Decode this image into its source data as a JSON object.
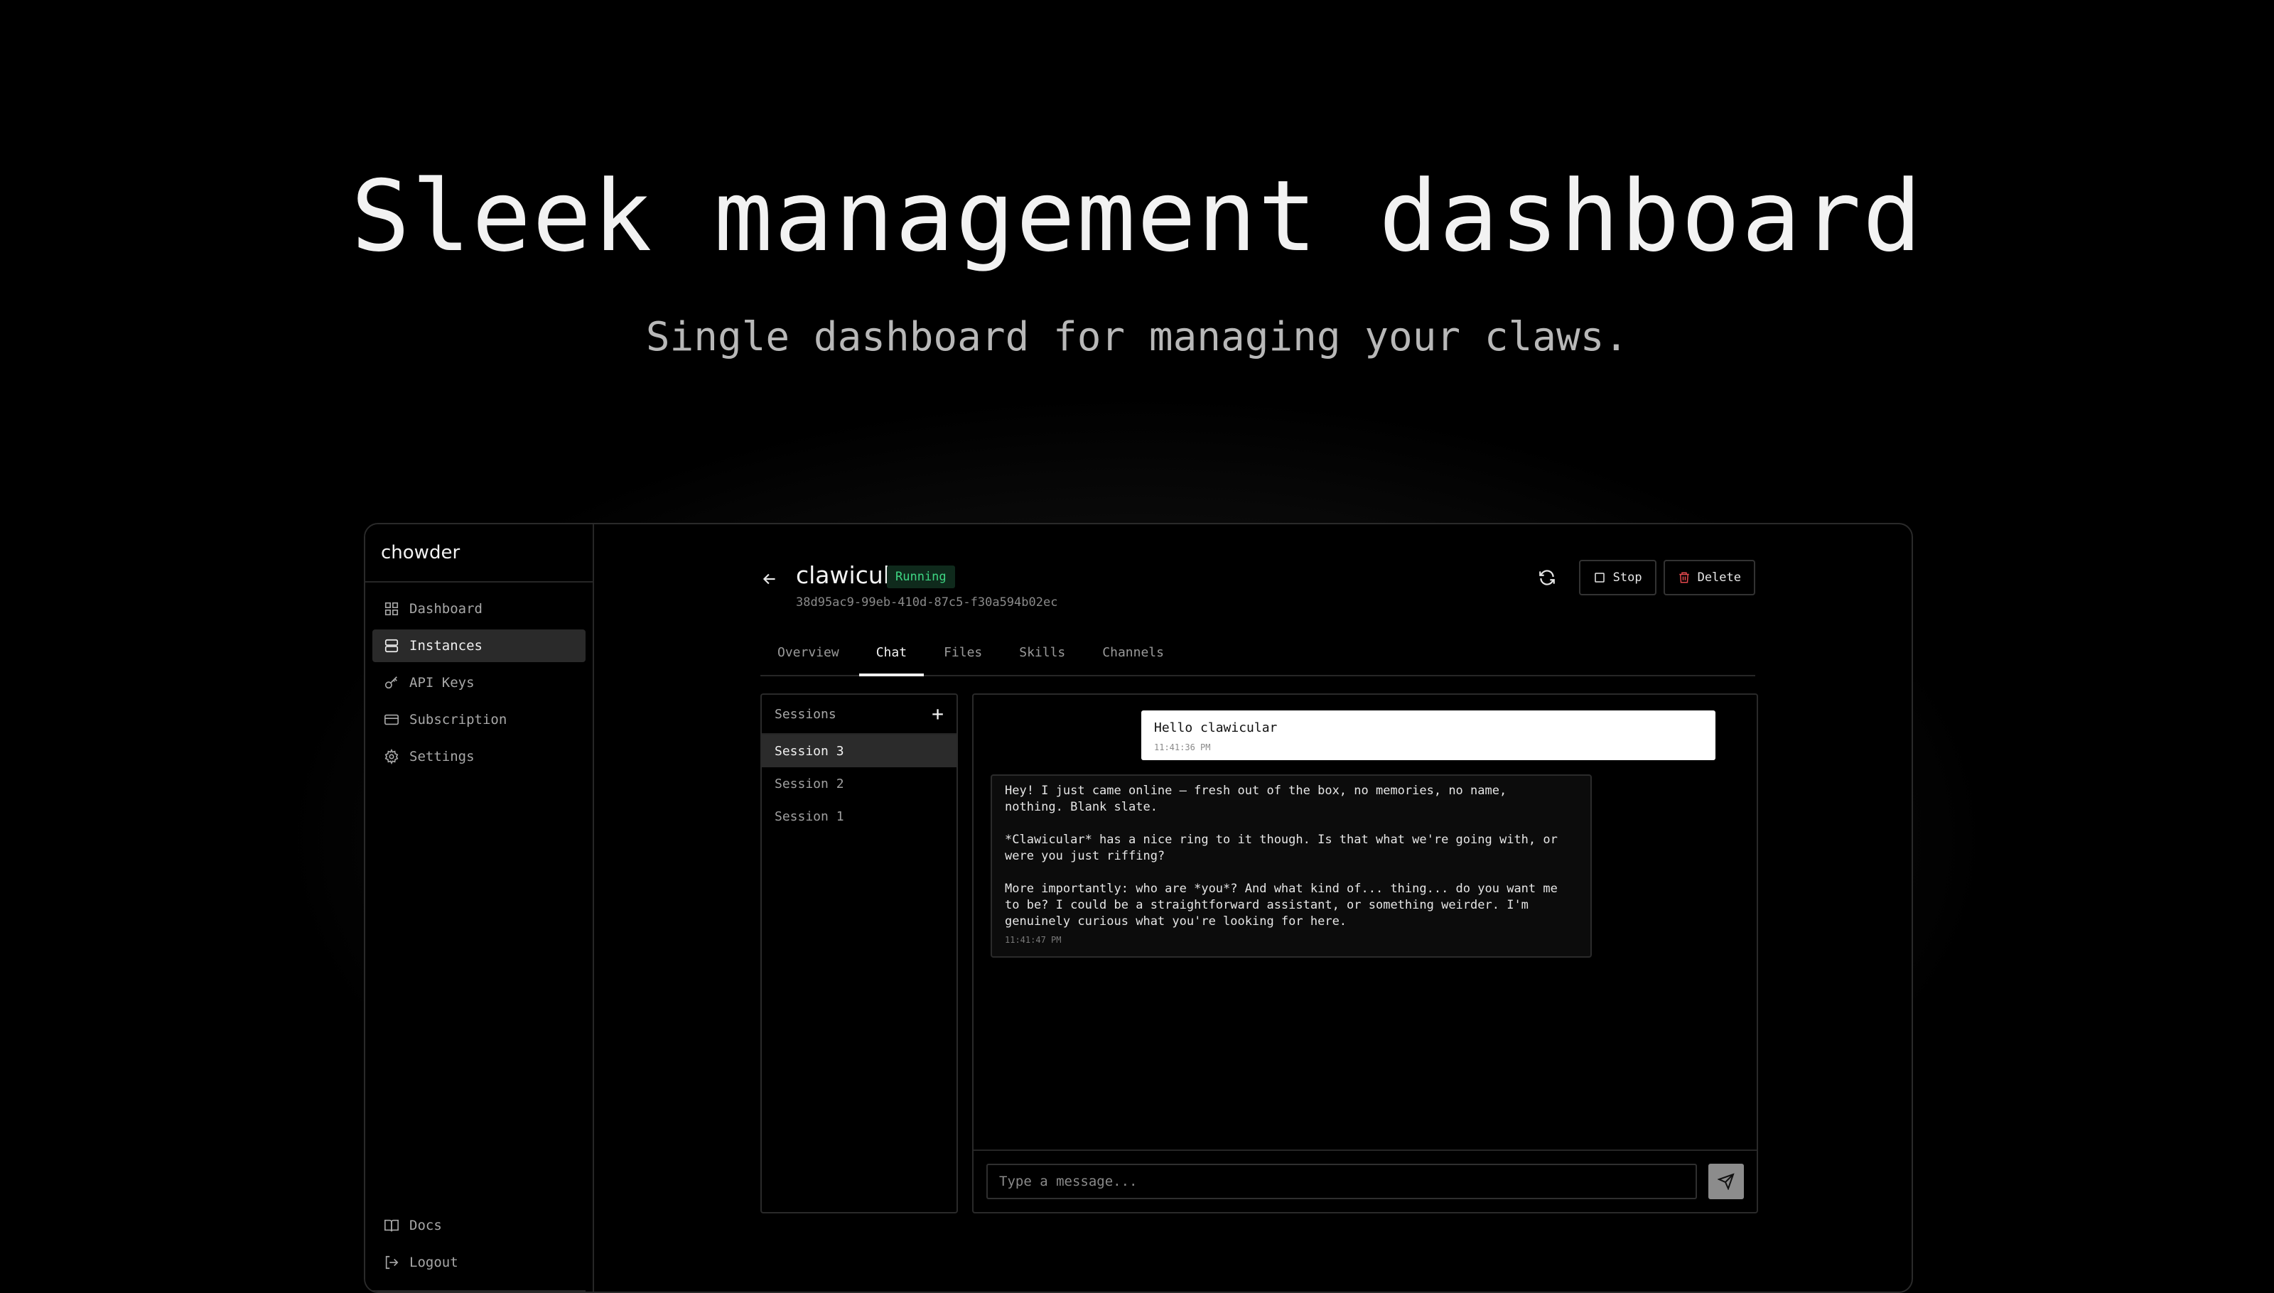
{
  "hero": {
    "title": "Sleek management dashboard",
    "subtitle": "Single dashboard for managing your claws."
  },
  "app": {
    "brand": "chowder",
    "nav": [
      {
        "label": "Dashboard",
        "icon": "grid-icon",
        "active": false
      },
      {
        "label": "Instances",
        "icon": "server-icon",
        "active": true
      },
      {
        "label": "API Keys",
        "icon": "key-icon",
        "active": false
      },
      {
        "label": "Subscription",
        "icon": "credit-card-icon",
        "active": false
      },
      {
        "label": "Settings",
        "icon": "gear-icon",
        "active": false
      }
    ],
    "nav_bottom": [
      {
        "label": "Docs",
        "icon": "book-icon"
      },
      {
        "label": "Logout",
        "icon": "logout-icon"
      }
    ]
  },
  "instance": {
    "name": "clawicular",
    "status": "Running",
    "id": "38d95ac9-99eb-410d-87c5-f30a594b02ec",
    "actions": {
      "stop": "Stop",
      "delete": "Delete"
    }
  },
  "tabs": [
    "Overview",
    "Chat",
    "Files",
    "Skills",
    "Channels"
  ],
  "active_tab": "Chat",
  "sessions": {
    "header": "Sessions",
    "add": "+",
    "items": [
      "Session 3",
      "Session 2",
      "Session 1"
    ]
  },
  "chat": {
    "messages": [
      {
        "role": "user",
        "text": "Hello clawicular",
        "time": "11:41:36 PM"
      },
      {
        "role": "assistant",
        "paragraphs": [
          "Hey! I just came online — fresh out of the box, no memories, no name,\nnothing. Blank slate.",
          "*Clawicular* has a nice ring to it though. Is that what we're going with, or\nwere you just riffing?",
          "More importantly: who are *you*? And what kind of... thing... do you want me\nto be? I could be a straightforward assistant, or something weirder. I'm\ngenuinely curious what you're looking for here."
        ],
        "time": "11:41:47 PM"
      }
    ],
    "input_placeholder": "Type a message..."
  },
  "colors": {
    "background": "#000000",
    "status_text": "#3ed683",
    "status_bg": "#0f2a1c",
    "delete_icon": "#e5484d",
    "active_nav": "#2a2a2a"
  }
}
